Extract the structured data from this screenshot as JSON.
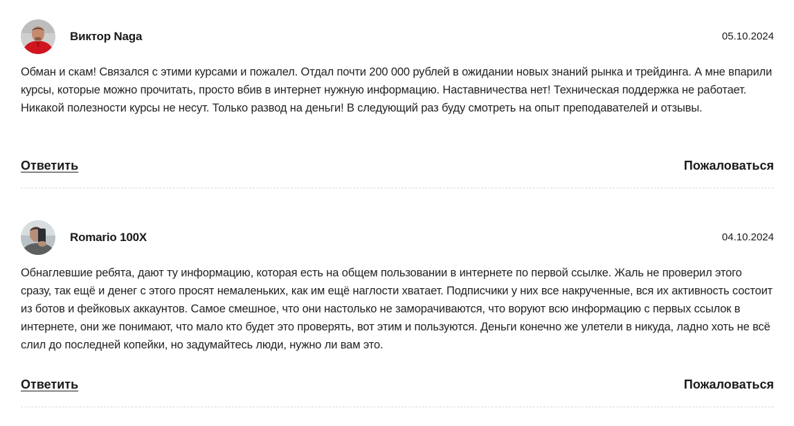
{
  "comments": [
    {
      "author": "Виктор Naga",
      "date": "05.10.2024",
      "text": "Обман и скам! Связался с этими курсами и пожалел. Отдал почти 200 000 рублей в ожидании новых знаний рынка и трейдинга. А мне впарили курсы, которые можно прочитать, просто вбив в интернет нужную информацию. Наставничества нет! Техническая поддержка не работает. Никакой полезности курсы не несут. Только развод на деньги! В следующий раз буду смотреть на опыт преподавателей и отзывы.",
      "reply_label": "Ответить",
      "report_label": "Пожаловаться"
    },
    {
      "author": "Romario 100X",
      "date": "04.10.2024",
      "text": "Обнаглевшие ребята, дают ту информацию, которая есть на общем пользовании в интернете по первой ссылке. Жаль не проверил этого сразу, так ещё и денег с этого просят немаленьких, как им ещё наглости хватает. Подписчики у них все накрученные, вся их активность состоит из ботов и фейковых аккаунтов. Самое смешное, что они настолько не заморачиваются, что воруют всю информацию с первых ссылок в интернете, они же понимают, что мало кто будет это проверять, вот этим и пользуются. Деньги конечно же улетели в никуда, ладно хоть не всё слил до последней копейки, но задумайтесь люди, нужно ли вам это.",
      "reply_label": "Ответить",
      "report_label": "Пожаловаться"
    }
  ]
}
